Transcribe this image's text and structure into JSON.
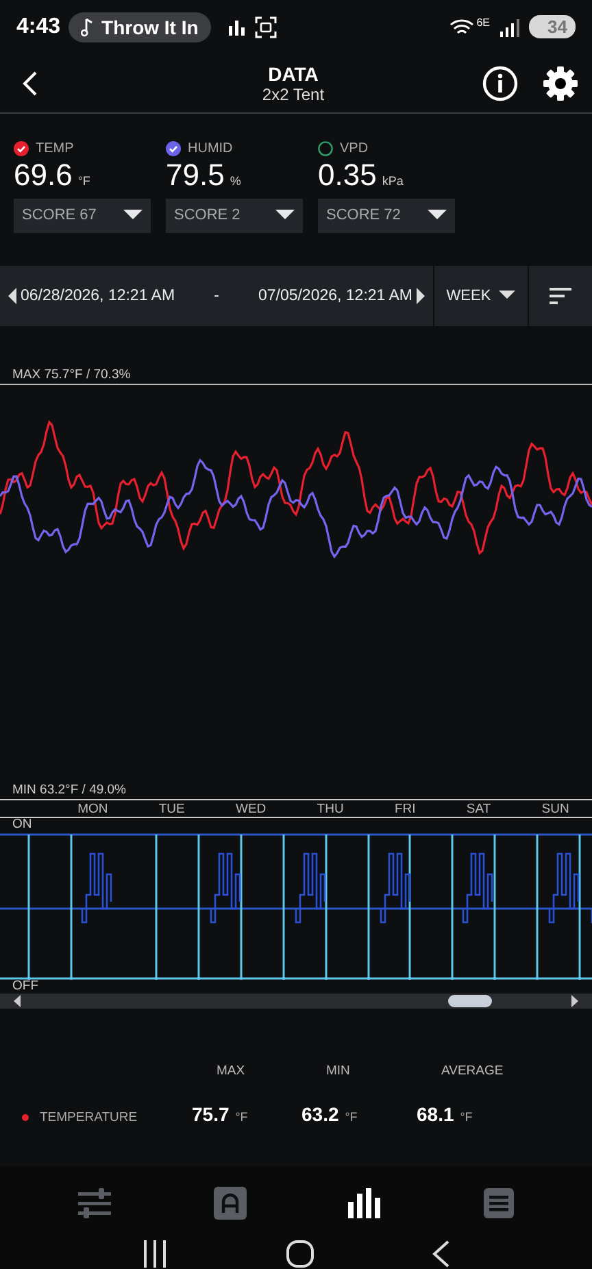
{
  "status_bar": {
    "time": "4:43",
    "media": "Throw It In",
    "network": "6E",
    "battery": "34"
  },
  "header": {
    "title": "DATA",
    "subtitle": "2x2 Tent"
  },
  "metrics": [
    {
      "label": "TEMP",
      "value": "69.6",
      "unit": "°F",
      "checked": true,
      "color": "#e5202f",
      "score": "SCORE 67"
    },
    {
      "label": "HUMID",
      "value": "79.5",
      "unit": "%",
      "checked": true,
      "color": "#6b63e8",
      "score": "SCORE 2"
    },
    {
      "label": "VPD",
      "value": "0.35",
      "unit": "kPa",
      "checked": false,
      "color": "#2f9e6a",
      "score": "SCORE 72"
    }
  ],
  "date_range": {
    "start": "06/28/2026, 12:21 AM",
    "separator": "-",
    "end": "07/05/2026, 12:21 AM",
    "period": "WEEK"
  },
  "chart": {
    "max_label": "MAX 75.7°F / 70.3%",
    "min_label": "MIN 63.2°F / 49.0%"
  },
  "days": [
    "MON",
    "TUE",
    "WED",
    "THU",
    "FRI",
    "SAT",
    "SUN"
  ],
  "device_chart": {
    "on_label": "ON",
    "off_label": "OFF"
  },
  "stats": {
    "columns": [
      "MAX",
      "MIN",
      "AVERAGE"
    ],
    "rows": [
      {
        "label": "TEMPERATURE",
        "color": "#e5202f",
        "max": "75.7",
        "min": "63.2",
        "average": "68.1",
        "max_unit": "°F",
        "min_unit": "°F",
        "average_unit": "°F"
      }
    ]
  },
  "bottom_nav": [
    {
      "kind": "sliders",
      "selected": false
    },
    {
      "kind": "auto",
      "selected": false
    },
    {
      "kind": "chart",
      "selected": true
    },
    {
      "kind": "list",
      "selected": false
    }
  ]
}
